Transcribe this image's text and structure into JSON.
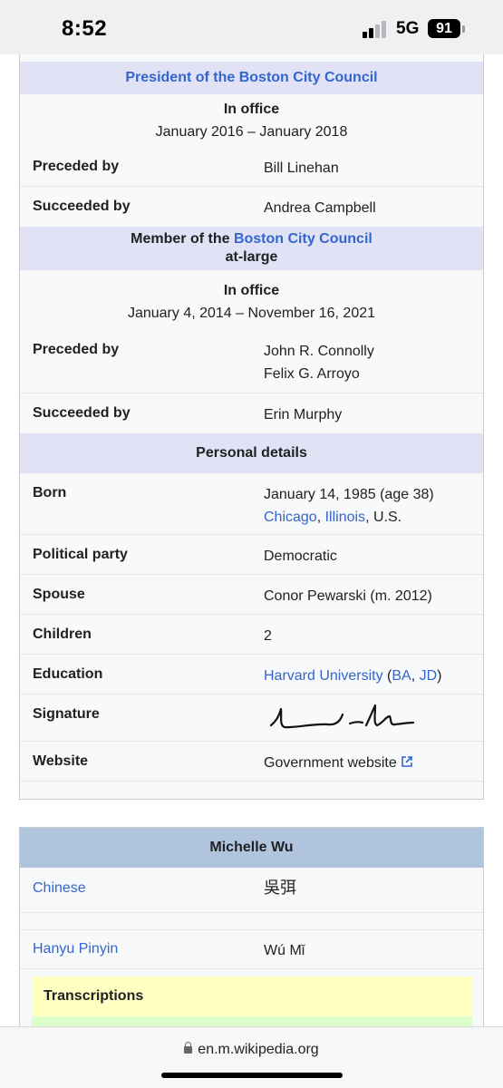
{
  "status_bar": {
    "time": "8:52",
    "network": "5G",
    "battery": "91"
  },
  "infobox": {
    "president_header": "President of the Boston City Council",
    "office1": {
      "label": "In office",
      "dates": "January 2016 – January 2018"
    },
    "preceded_label": "Preceded by",
    "succeeded_label": "Succeeded by",
    "office1_preceded": "Bill Linehan",
    "office1_succeeded": "Andrea Campbell",
    "member_header": {
      "prefix": "Member of the ",
      "link": "Boston City Council",
      "suffix": "at-large"
    },
    "office2": {
      "label": "In office",
      "dates": "January 4, 2014 – November 16, 2021"
    },
    "office2_preceded_1": "John R. Connolly",
    "office2_preceded_2": "Felix G. Arroyo",
    "office2_succeeded": "Erin Murphy",
    "personal_header": "Personal details",
    "born": {
      "label": "Born",
      "date": "January 14, 1985 (age 38)",
      "city": "Chicago",
      "comma": ", ",
      "state": "Illinois",
      "country": ", U.S."
    },
    "party": {
      "label": "Political party",
      "value": "Democratic"
    },
    "spouse": {
      "label": "Spouse",
      "value": "Conor Pewarski (m. 2012)"
    },
    "children": {
      "label": "Children",
      "value": "2"
    },
    "education": {
      "label": "Education",
      "school": "Harvard University",
      "open": " (",
      "deg1": "BA",
      "sep": ", ",
      "deg2": "JD",
      "close": ")"
    },
    "signature": {
      "label": "Signature"
    },
    "website": {
      "label": "Website",
      "value": "Government website"
    }
  },
  "name_box": {
    "title": "Michelle Wu",
    "chinese_label": "Chinese",
    "chinese_value": "吳弭",
    "pinyin_label": "Hanyu Pinyin",
    "pinyin_value": "Wú Mǐ",
    "transcriptions": "Transcriptions"
  },
  "browser": {
    "url": "en.m.wikipedia.org"
  }
}
